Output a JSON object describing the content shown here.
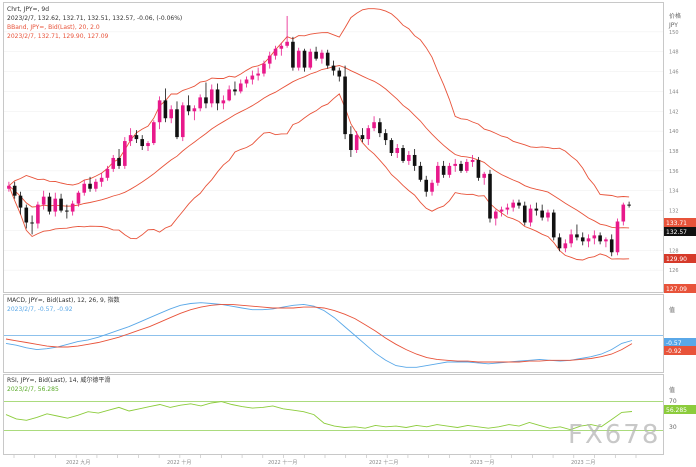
{
  "main": {
    "title": "Chrt, JPY=, 9d",
    "ohlc": "2023/2/7, 132.62, 132.71, 132.51, 132.57, -0.06, (-0.06%)",
    "bb_name": "BBand, JPY=, Bid(Last), 20, 2.0",
    "bb_values": "2023/2/7, 132.71, 129.90, 127.09",
    "price_header": "价格",
    "price_unit": "JPY",
    "last_price_tag": "132.57",
    "upper_tag": "133.71",
    "mid_tag": "129.90",
    "lower_tag": "127.09"
  },
  "macd": {
    "title": "MACD, JPY=, Bid(Last), 12, 26, 9, 指数",
    "values": "2023/2/7, -0.57, -0.92",
    "axis_label": "值",
    "macd_tag": "-0.57",
    "signal_tag": "-0.92"
  },
  "rsi": {
    "title": "RSI, JPY=, Bid(Last), 14, 威尔德平滑",
    "values": "2023/2/7, 56.285",
    "axis_label": "值",
    "rsi_tag": "56.285",
    "level_70": "70",
    "level_30": "30"
  },
  "watermark": "FX678",
  "colors": {
    "up": "#e8198b",
    "down": "#111111",
    "band": "#e8533a",
    "macd_line": "#5aa8e8",
    "signal_line": "#e8533a",
    "rsi_line": "#8ccc3c",
    "rsi_levels": "#9fd66b"
  },
  "chart_data": [
    {
      "type": "candlestick",
      "title": "Chrt, JPY=, 9d",
      "ylim": [
        124,
        152
      ],
      "y_ticks": [
        126,
        128,
        130,
        132,
        134,
        136,
        138,
        140,
        142,
        144,
        146,
        148,
        150
      ],
      "x_tick_labels": [
        "2022 九月",
        "2022 十月",
        "2022 十一月",
        "2022 十二月",
        "2023 一月",
        "2023 二月"
      ],
      "candles": [
        [
          134.2,
          134.9,
          133.9,
          134.5
        ],
        [
          134.5,
          134.9,
          133.2,
          133.5
        ],
        [
          133.5,
          133.9,
          131.6,
          132.3
        ],
        [
          132.3,
          132.6,
          130.2,
          130.8
        ],
        [
          130.8,
          131.5,
          129.6,
          130.7
        ],
        [
          130.7,
          132.9,
          130.2,
          132.6
        ],
        [
          132.6,
          134.0,
          132.1,
          133.4
        ],
        [
          133.4,
          133.8,
          131.6,
          131.9
        ],
        [
          131.9,
          133.8,
          131.4,
          133.2
        ],
        [
          133.2,
          133.7,
          131.8,
          132.0
        ],
        [
          132.0,
          132.6,
          131.2,
          131.9
        ],
        [
          131.9,
          133.0,
          131.5,
          132.7
        ],
        [
          132.7,
          134.0,
          132.4,
          133.8
        ],
        [
          133.8,
          135.1,
          133.5,
          134.7
        ],
        [
          134.7,
          135.4,
          133.9,
          134.2
        ],
        [
          134.2,
          135.2,
          133.9,
          134.9
        ],
        [
          134.9,
          135.8,
          134.4,
          135.3
        ],
        [
          135.3,
          136.5,
          135.0,
          136.2
        ],
        [
          136.2,
          137.6,
          135.9,
          137.3
        ],
        [
          137.3,
          138.2,
          136.2,
          136.5
        ],
        [
          136.5,
          139.4,
          136.2,
          139.0
        ],
        [
          139.0,
          140.3,
          138.5,
          139.6
        ],
        [
          139.6,
          140.1,
          138.8,
          139.2
        ],
        [
          139.2,
          139.6,
          138.1,
          138.5
        ],
        [
          138.5,
          139.0,
          138.0,
          138.8
        ],
        [
          138.8,
          141.1,
          138.6,
          140.9
        ],
        [
          140.9,
          143.5,
          140.2,
          143.1
        ],
        [
          143.1,
          144.3,
          140.9,
          141.3
        ],
        [
          141.3,
          142.6,
          140.8,
          142.2
        ],
        [
          142.2,
          143.0,
          139.2,
          139.4
        ],
        [
          139.4,
          142.9,
          139.0,
          142.6
        ],
        [
          142.6,
          143.6,
          141.6,
          142.0
        ],
        [
          142.0,
          142.6,
          141.1,
          142.3
        ],
        [
          142.3,
          143.7,
          142.0,
          143.4
        ],
        [
          143.4,
          144.9,
          142.3,
          142.8
        ],
        [
          142.8,
          144.7,
          142.4,
          144.2
        ],
        [
          144.2,
          144.8,
          142.1,
          142.8
        ],
        [
          142.8,
          143.6,
          142.2,
          143.1
        ],
        [
          143.1,
          144.6,
          143.0,
          144.2
        ],
        [
          144.2,
          145.0,
          143.6,
          144.0
        ],
        [
          144.0,
          145.2,
          143.8,
          144.8
        ],
        [
          144.8,
          145.5,
          144.4,
          145.2
        ],
        [
          145.2,
          146.1,
          144.7,
          145.6
        ],
        [
          145.6,
          146.4,
          145.1,
          145.8
        ],
        [
          145.8,
          147.1,
          145.5,
          146.8
        ],
        [
          146.8,
          148.0,
          146.3,
          147.6
        ],
        [
          147.6,
          148.6,
          147.2,
          148.3
        ],
        [
          148.3,
          148.9,
          147.6,
          148.6
        ],
        [
          148.6,
          151.6,
          148.4,
          149.0
        ],
        [
          149.0,
          149.5,
          146.1,
          146.4
        ],
        [
          146.4,
          148.4,
          146.1,
          148.1
        ],
        [
          148.1,
          148.3,
          146.0,
          146.4
        ],
        [
          146.4,
          148.3,
          146.2,
          148.0
        ],
        [
          148.0,
          148.5,
          147.1,
          147.3
        ],
        [
          147.3,
          148.2,
          146.8,
          147.9
        ],
        [
          147.9,
          148.2,
          146.3,
          146.6
        ],
        [
          146.6,
          147.1,
          145.6,
          146.1
        ],
        [
          146.1,
          146.4,
          145.0,
          145.5
        ],
        [
          145.5,
          146.6,
          139.2,
          139.7
        ],
        [
          139.7,
          140.5,
          137.4,
          138.1
        ],
        [
          138.1,
          140.0,
          137.8,
          139.6
        ],
        [
          139.6,
          140.3,
          138.9,
          139.2
        ],
        [
          139.2,
          140.6,
          138.6,
          140.3
        ],
        [
          140.3,
          141.5,
          140.0,
          140.9
        ],
        [
          140.9,
          141.3,
          139.4,
          139.8
        ],
        [
          139.8,
          140.2,
          138.6,
          139.1
        ],
        [
          139.1,
          139.3,
          137.5,
          137.8
        ],
        [
          137.8,
          138.7,
          137.3,
          138.3
        ],
        [
          138.3,
          138.6,
          136.8,
          137.0
        ],
        [
          137.0,
          138.0,
          136.6,
          137.6
        ],
        [
          137.6,
          138.2,
          136.0,
          136.5
        ],
        [
          136.5,
          136.9,
          134.9,
          135.1
        ],
        [
          135.1,
          135.5,
          133.4,
          133.9
        ],
        [
          133.9,
          135.1,
          133.5,
          134.8
        ],
        [
          134.8,
          136.9,
          134.5,
          136.5
        ],
        [
          136.5,
          137.0,
          135.3,
          135.6
        ],
        [
          135.6,
          136.8,
          135.3,
          136.5
        ],
        [
          136.5,
          137.2,
          135.9,
          136.7
        ],
        [
          136.7,
          137.0,
          135.8,
          136.0
        ],
        [
          136.0,
          137.2,
          135.8,
          136.9
        ],
        [
          136.9,
          137.6,
          136.4,
          137.1
        ],
        [
          137.1,
          137.4,
          135.0,
          135.3
        ],
        [
          135.3,
          135.9,
          134.6,
          135.7
        ],
        [
          135.7,
          136.1,
          130.8,
          131.2
        ],
        [
          131.2,
          132.1,
          130.5,
          131.9
        ],
        [
          131.9,
          132.4,
          131.4,
          132.1
        ],
        [
          132.1,
          132.7,
          131.6,
          132.3
        ],
        [
          132.3,
          133.1,
          131.9,
          132.8
        ],
        [
          132.8,
          133.1,
          132.2,
          132.5
        ],
        [
          132.5,
          132.9,
          130.5,
          130.8
        ],
        [
          130.8,
          132.6,
          130.4,
          132.2
        ],
        [
          132.2,
          132.8,
          131.5,
          132.0
        ],
        [
          132.0,
          132.6,
          131.0,
          131.3
        ],
        [
          131.3,
          132.1,
          130.9,
          131.8
        ],
        [
          131.8,
          132.1,
          129.0,
          129.3
        ],
        [
          129.3,
          129.7,
          127.9,
          128.2
        ],
        [
          128.2,
          129.1,
          127.8,
          128.7
        ],
        [
          128.7,
          130.1,
          128.3,
          129.6
        ],
        [
          129.6,
          130.6,
          129.0,
          129.3
        ],
        [
          129.3,
          129.8,
          128.5,
          128.9
        ],
        [
          128.9,
          129.6,
          128.3,
          129.2
        ],
        [
          129.2,
          130.0,
          128.6,
          129.5
        ],
        [
          129.5,
          129.8,
          128.6,
          128.9
        ],
        [
          128.9,
          129.3,
          128.3,
          129.1
        ],
        [
          129.1,
          129.6,
          127.4,
          127.8
        ],
        [
          127.8,
          131.2,
          127.5,
          130.9
        ],
        [
          130.9,
          132.8,
          130.5,
          132.6
        ],
        [
          132.6,
          132.9,
          132.3,
          132.57
        ]
      ],
      "bollinger": {
        "period": 20,
        "stddev": 2.0,
        "last": {
          "upper": 133.71,
          "middle": 129.9,
          "lower": 127.09
        }
      }
    },
    {
      "type": "line",
      "title": "MACD, JPY=, Bid(Last), 12, 26, 9, 指数",
      "series": [
        {
          "name": "MACD",
          "values": [
            -0.9,
            -1.1,
            -1.4,
            -1.6,
            -1.5,
            -1.3,
            -1.0,
            -0.7,
            -0.5,
            -0.2,
            0.2,
            0.6,
            1.0,
            1.5,
            2.0,
            2.5,
            3.0,
            3.4,
            3.6,
            3.7,
            3.6,
            3.5,
            3.3,
            3.1,
            2.9,
            2.9,
            3.0,
            3.2,
            3.4,
            3.5,
            3.3,
            2.8,
            2.0,
            1.0,
            0.0,
            -1.0,
            -2.0,
            -2.8,
            -3.4,
            -3.6,
            -3.6,
            -3.4,
            -3.2,
            -3.0,
            -3.0,
            -3.0,
            -3.1,
            -3.2,
            -3.1,
            -3.0,
            -2.9,
            -2.8,
            -2.7,
            -2.8,
            -2.9,
            -2.8,
            -2.6,
            -2.4,
            -2.1,
            -1.6,
            -0.9,
            -0.57
          ]
        },
        {
          "name": "Signal",
          "values": [
            -0.4,
            -0.6,
            -0.8,
            -1.0,
            -1.2,
            -1.3,
            -1.3,
            -1.2,
            -1.0,
            -0.8,
            -0.5,
            -0.2,
            0.2,
            0.6,
            1.0,
            1.5,
            2.0,
            2.5,
            2.9,
            3.2,
            3.4,
            3.5,
            3.5,
            3.4,
            3.3,
            3.2,
            3.1,
            3.1,
            3.1,
            3.2,
            3.2,
            3.1,
            2.8,
            2.4,
            1.9,
            1.2,
            0.5,
            -0.3,
            -1.0,
            -1.6,
            -2.1,
            -2.5,
            -2.7,
            -2.8,
            -2.9,
            -2.9,
            -3.0,
            -3.0,
            -3.0,
            -3.0,
            -3.0,
            -2.9,
            -2.9,
            -2.8,
            -2.8,
            -2.8,
            -2.7,
            -2.6,
            -2.4,
            -2.1,
            -1.6,
            -0.92
          ]
        }
      ],
      "zero_line": 0,
      "last": {
        "macd": -0.57,
        "signal": -0.92
      }
    },
    {
      "type": "line",
      "title": "RSI, JPY=, Bid(Last), 14, 威尔德平滑",
      "ylim": [
        0,
        100
      ],
      "levels": [
        70,
        30
      ],
      "series": [
        {
          "name": "RSI",
          "values": [
            52,
            46,
            44,
            48,
            53,
            50,
            47,
            51,
            56,
            54,
            58,
            62,
            57,
            60,
            63,
            66,
            62,
            65,
            67,
            64,
            68,
            70,
            66,
            63,
            61,
            62,
            64,
            60,
            58,
            56,
            52,
            40,
            36,
            34,
            35,
            33,
            37,
            35,
            36,
            34,
            37,
            35,
            38,
            36,
            34,
            37,
            35,
            33,
            35,
            38,
            36,
            41,
            37,
            33,
            35,
            31,
            36,
            38,
            35,
            45,
            55,
            56.285
          ]
        }
      ],
      "last": 56.285
    }
  ]
}
